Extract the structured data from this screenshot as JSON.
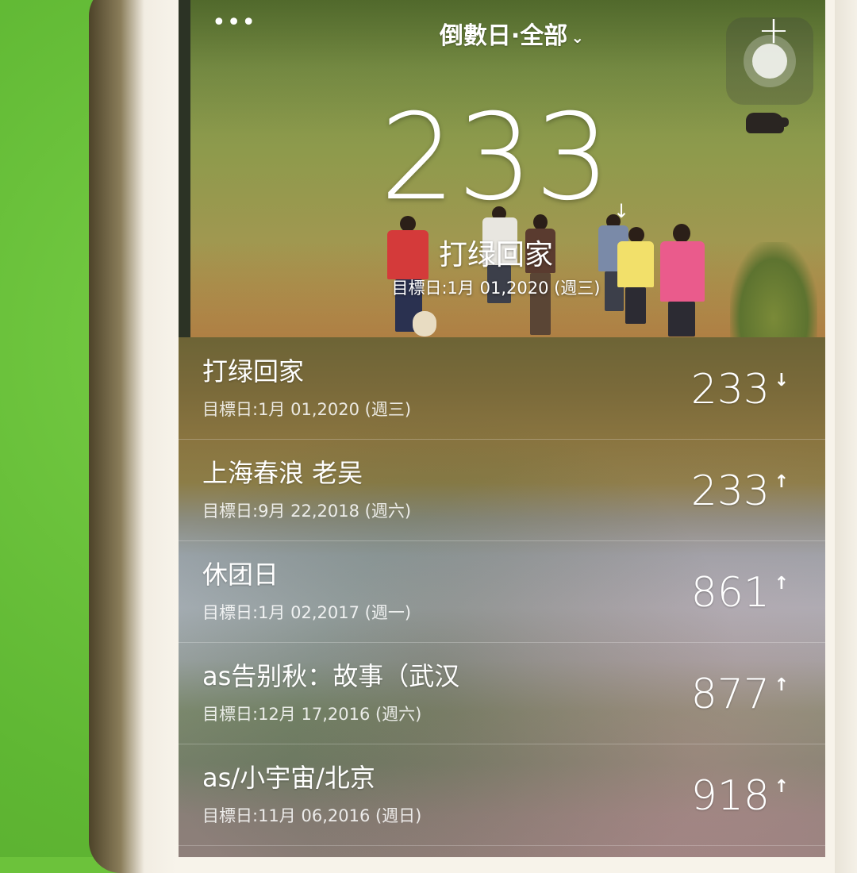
{
  "header": {
    "more_label": "•••",
    "title": "倒數日·全部",
    "chevron": "⌄",
    "add_label": "+"
  },
  "featured": {
    "count": "233",
    "direction_icon": "↓",
    "name": "打绿回家",
    "date": "目標日:1月 01,2020 (週三)"
  },
  "events": [
    {
      "name": "打绿回家",
      "date": "目標日:1月 01,2020 (週三)",
      "count": "233",
      "direction": "↓"
    },
    {
      "name": "上海春浪 老吴",
      "date": "目標日:9月 22,2018 (週六)",
      "count": "233",
      "direction": "↑"
    },
    {
      "name": "休团日",
      "date": "目標日:1月 02,2017 (週一)",
      "count": "861",
      "direction": "↑"
    },
    {
      "name": "as告别秋：故事（武汉",
      "date": "目標日:12月 17,2016 (週六)",
      "count": "877",
      "direction": "↑"
    },
    {
      "name": "as/小宇宙/北京",
      "date": "目標日:11月 06,2016 (週日)",
      "count": "918",
      "direction": "↑"
    }
  ],
  "icons": {
    "more": "more-icon",
    "add": "plus-icon",
    "assistive_touch": "assistive-touch-icon",
    "countdown_down": "arrow-down-icon",
    "countup": "arrow-up-icon"
  }
}
